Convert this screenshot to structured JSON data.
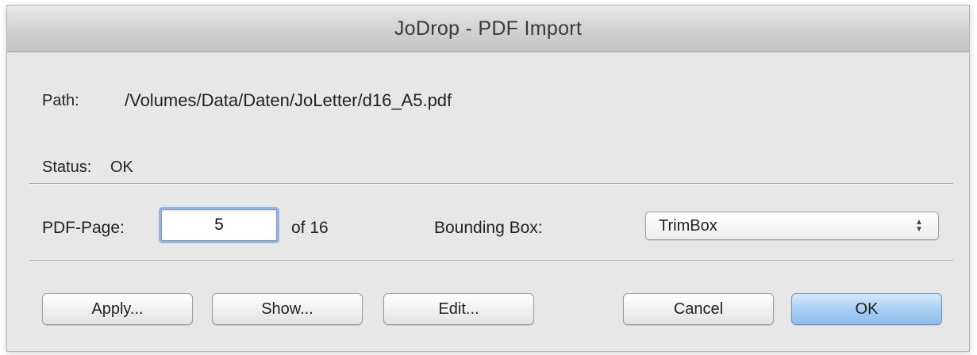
{
  "window": {
    "title": "JoDrop - PDF Import"
  },
  "path": {
    "label": "Path:",
    "value": "/Volumes/Data/Daten/JoLetter/d16_A5.pdf"
  },
  "status": {
    "label": "Status:",
    "value": "OK"
  },
  "pdf_page": {
    "label": "PDF-Page:",
    "value": "5",
    "of_text": "of 16"
  },
  "bounding_box": {
    "label": "Bounding Box:",
    "selected": "TrimBox",
    "icon": "up-down-arrows-icon"
  },
  "buttons": {
    "apply": "Apply...",
    "show": "Show...",
    "edit": "Edit...",
    "cancel": "Cancel",
    "ok": "OK"
  },
  "colors": {
    "default_button": "#a9cff3",
    "focus_ring": "#8fb6e8"
  }
}
